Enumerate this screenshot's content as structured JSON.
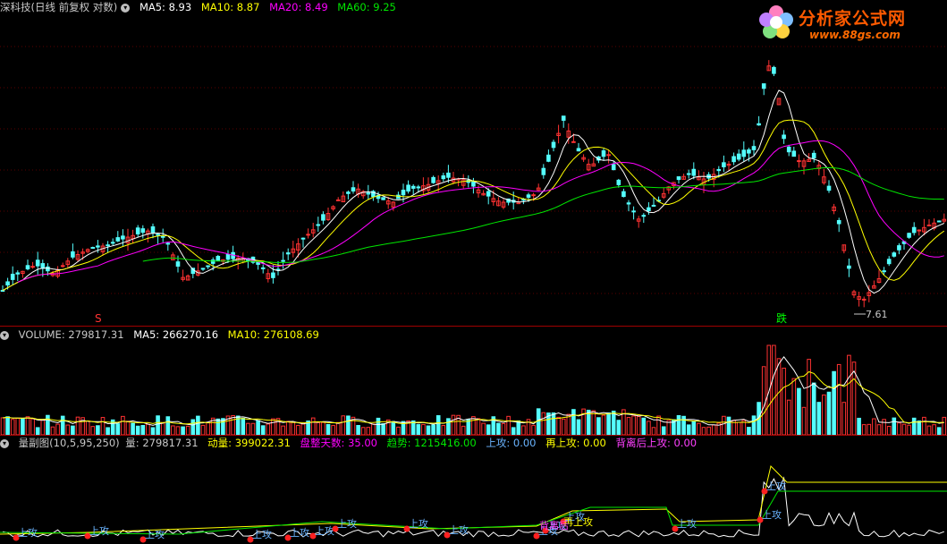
{
  "main": {
    "title": "深科技(日线 前复权 对数)",
    "ma5": "MA5: 8.93",
    "ma10": "MA10: 8.87",
    "ma20": "MA20: 8.49",
    "ma60": "MA60: 9.25",
    "low_label": "7.61",
    "signal_s": "S",
    "signal_fall": "跌"
  },
  "volume": {
    "label": "VOLUME: 279817.31",
    "ma5": "MA5: 266270.16",
    "ma10": "MA10: 276108.69"
  },
  "indicator": {
    "name": "量副图(10,5,95,250)",
    "vol": "量: 279817.31",
    "dongliang": "动量: 399022.31",
    "panzheng": "盘整天数: 35.00",
    "qushi": "趋势: 1215416.00",
    "shanggong": "上攻: 0.00",
    "zaishanggong": "再上攻: 0.00",
    "beili": "背离后上攻: 0.00",
    "tag_up": "上攻",
    "tag_zai": "再上攻",
    "tag_bei": "背离后"
  },
  "logo": {
    "name": "分析家公式网",
    "url": "www.88gs.com"
  },
  "colors": {
    "up": "#ff3232",
    "down": "#54ffff",
    "ma5": "#ffffff",
    "ma10": "#ffff00",
    "ma20": "#ff00ff",
    "ma60": "#00e600"
  }
}
